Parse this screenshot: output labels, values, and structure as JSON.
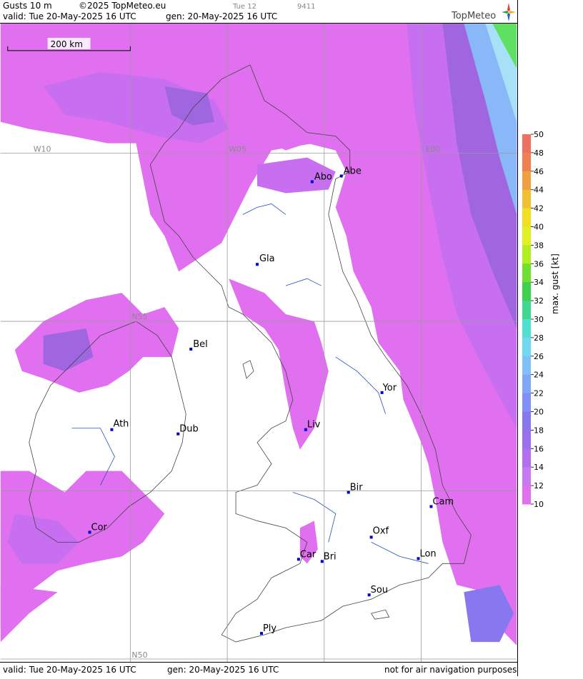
{
  "header": {
    "product": "Gusts 10 m",
    "copyright": "©2025 TopMeteo.eu",
    "day_short": "Tue 12",
    "code": "9411",
    "valid": "valid:  Tue  20-May-2025  16 UTC",
    "generated": "gen: 20-May-2025 16 UTC",
    "brand": "TopMeteo"
  },
  "footer": {
    "valid": "valid:  Tue  20-May-2025  16 UTC",
    "generated": "gen: 20-May-2025 16 UTC",
    "disclaimer": "not for air navigation purposes"
  },
  "scale_bar": {
    "label": "200 km"
  },
  "grid_labels": {
    "w10": "W10",
    "w05": "W05",
    "e00": "E00",
    "n55": "N55",
    "n50": "N50"
  },
  "cities": [
    {
      "name": "Abo",
      "id": "abo"
    },
    {
      "name": "Abe",
      "id": "abe"
    },
    {
      "name": "Gla",
      "id": "gla"
    },
    {
      "name": "Bel",
      "id": "bel"
    },
    {
      "name": "Yor",
      "id": "yor"
    },
    {
      "name": "Ath",
      "id": "ath"
    },
    {
      "name": "Dub",
      "id": "dub"
    },
    {
      "name": "Liv",
      "id": "liv"
    },
    {
      "name": "Bir",
      "id": "bir"
    },
    {
      "name": "Cam",
      "id": "cam"
    },
    {
      "name": "Cor",
      "id": "cor"
    },
    {
      "name": "Oxf",
      "id": "oxf"
    },
    {
      "name": "Car",
      "id": "car"
    },
    {
      "name": "Bri",
      "id": "bri"
    },
    {
      "name": "Lon",
      "id": "lon"
    },
    {
      "name": "Sou",
      "id": "sou"
    },
    {
      "name": "Ply",
      "id": "ply"
    }
  ],
  "legend": {
    "title": "max. gust [kt]",
    "ticks": [
      "50",
      "48",
      "46",
      "44",
      "42",
      "40",
      "38",
      "36",
      "34",
      "32",
      "30",
      "28",
      "26",
      "24",
      "22",
      "20",
      "18",
      "16",
      "14",
      "12",
      "10"
    ],
    "colors": [
      "#f07060",
      "#f08050",
      "#f0a040",
      "#f0c030",
      "#f0e020",
      "#e0f020",
      "#b0f020",
      "#70e030",
      "#40d050",
      "#40d890",
      "#50e0d0",
      "#70d8f0",
      "#80c0f8",
      "#80a8f8",
      "#8090f8",
      "#8878f0",
      "#9a70f0",
      "#b070f0",
      "#c878f0",
      "#e070f0"
    ],
    "gust_colors": {
      "c12": "#e070f0",
      "c14": "#c86ef0",
      "c16": "#a066e0",
      "c18": "#8878f0",
      "c24": "#88b8f8",
      "c28": "#a8e0f8",
      "c30": "#60e060"
    }
  }
}
